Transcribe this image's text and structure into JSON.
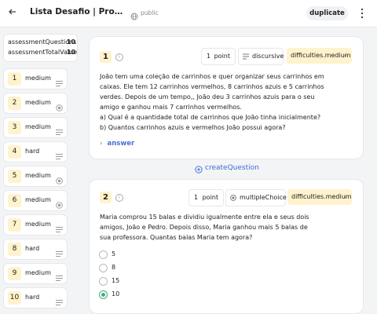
{
  "header": {
    "title": "Lista Desafio | Problemas de Matemática",
    "visibility": "public",
    "duplicate_label": "duplicate"
  },
  "sidebar": {
    "assessment_questions_label": "assessmentQuestions",
    "assessment_questions_value": "10",
    "assessment_total_value_label": "assessmentTotalValue",
    "assessment_total_value": "10",
    "items": [
      {
        "num": "1",
        "level": "medium",
        "icon": "lines-icon"
      },
      {
        "num": "2",
        "level": "medium",
        "icon": "radio-icon"
      },
      {
        "num": "3",
        "level": "medium",
        "icon": "lines-icon"
      },
      {
        "num": "4",
        "level": "hard",
        "icon": "lines-icon"
      },
      {
        "num": "5",
        "level": "medium",
        "icon": "radio-icon"
      },
      {
        "num": "6",
        "level": "medium",
        "icon": "radio-icon"
      },
      {
        "num": "7",
        "level": "medium",
        "icon": "lines-icon"
      },
      {
        "num": "8",
        "level": "hard",
        "icon": "lines-icon"
      },
      {
        "num": "9",
        "level": "medium",
        "icon": "lines-icon"
      },
      {
        "num": "10",
        "level": "hard",
        "icon": "lines-icon"
      }
    ]
  },
  "questions": [
    {
      "num": "1",
      "points": "1",
      "points_label": "point",
      "type": "discursive",
      "difficulty": "difficulties.medium",
      "text": [
        "João tem uma coleção de carrinhos e quer organizar seus carrinhos em caixas. Ele tem 12 carrinhos vermelhos, 8 carrinhos azuis e 5 carrinhos verdes.  Depois de um tempo,, João deu 3 carrinhos azuis para o seu amigo e ganhou mais 7 carrinhos vermelhos.",
        "a) Qual é a quantidade total de carrinhos que João tinha inicialmente?",
        "b) Quantos carrinhos azuis e vermelhos João possui agora?"
      ],
      "answer_label": "answer"
    },
    {
      "num": "2",
      "points": "1",
      "points_label": "point",
      "type": "multipleChoice",
      "difficulty": "difficulties.medium",
      "text": [
        "Maria comprou 15 balas e dividiu igualmente entre ela e seus dois amigos, João e Pedro. Depois disso, Maria ganhou mais 5 balas de sua professora. Quantas balas Maria tem agora?"
      ],
      "options": [
        {
          "label": "5",
          "selected": false
        },
        {
          "label": "8",
          "selected": false
        },
        {
          "label": "15",
          "selected": false
        },
        {
          "label": "10",
          "selected": true
        }
      ]
    }
  ],
  "create_question_label": "createQuestion",
  "colors": {
    "accent": "#4a6fd8",
    "badge_bg": "#fff3cd",
    "selected_radio": "#3fae7c"
  }
}
